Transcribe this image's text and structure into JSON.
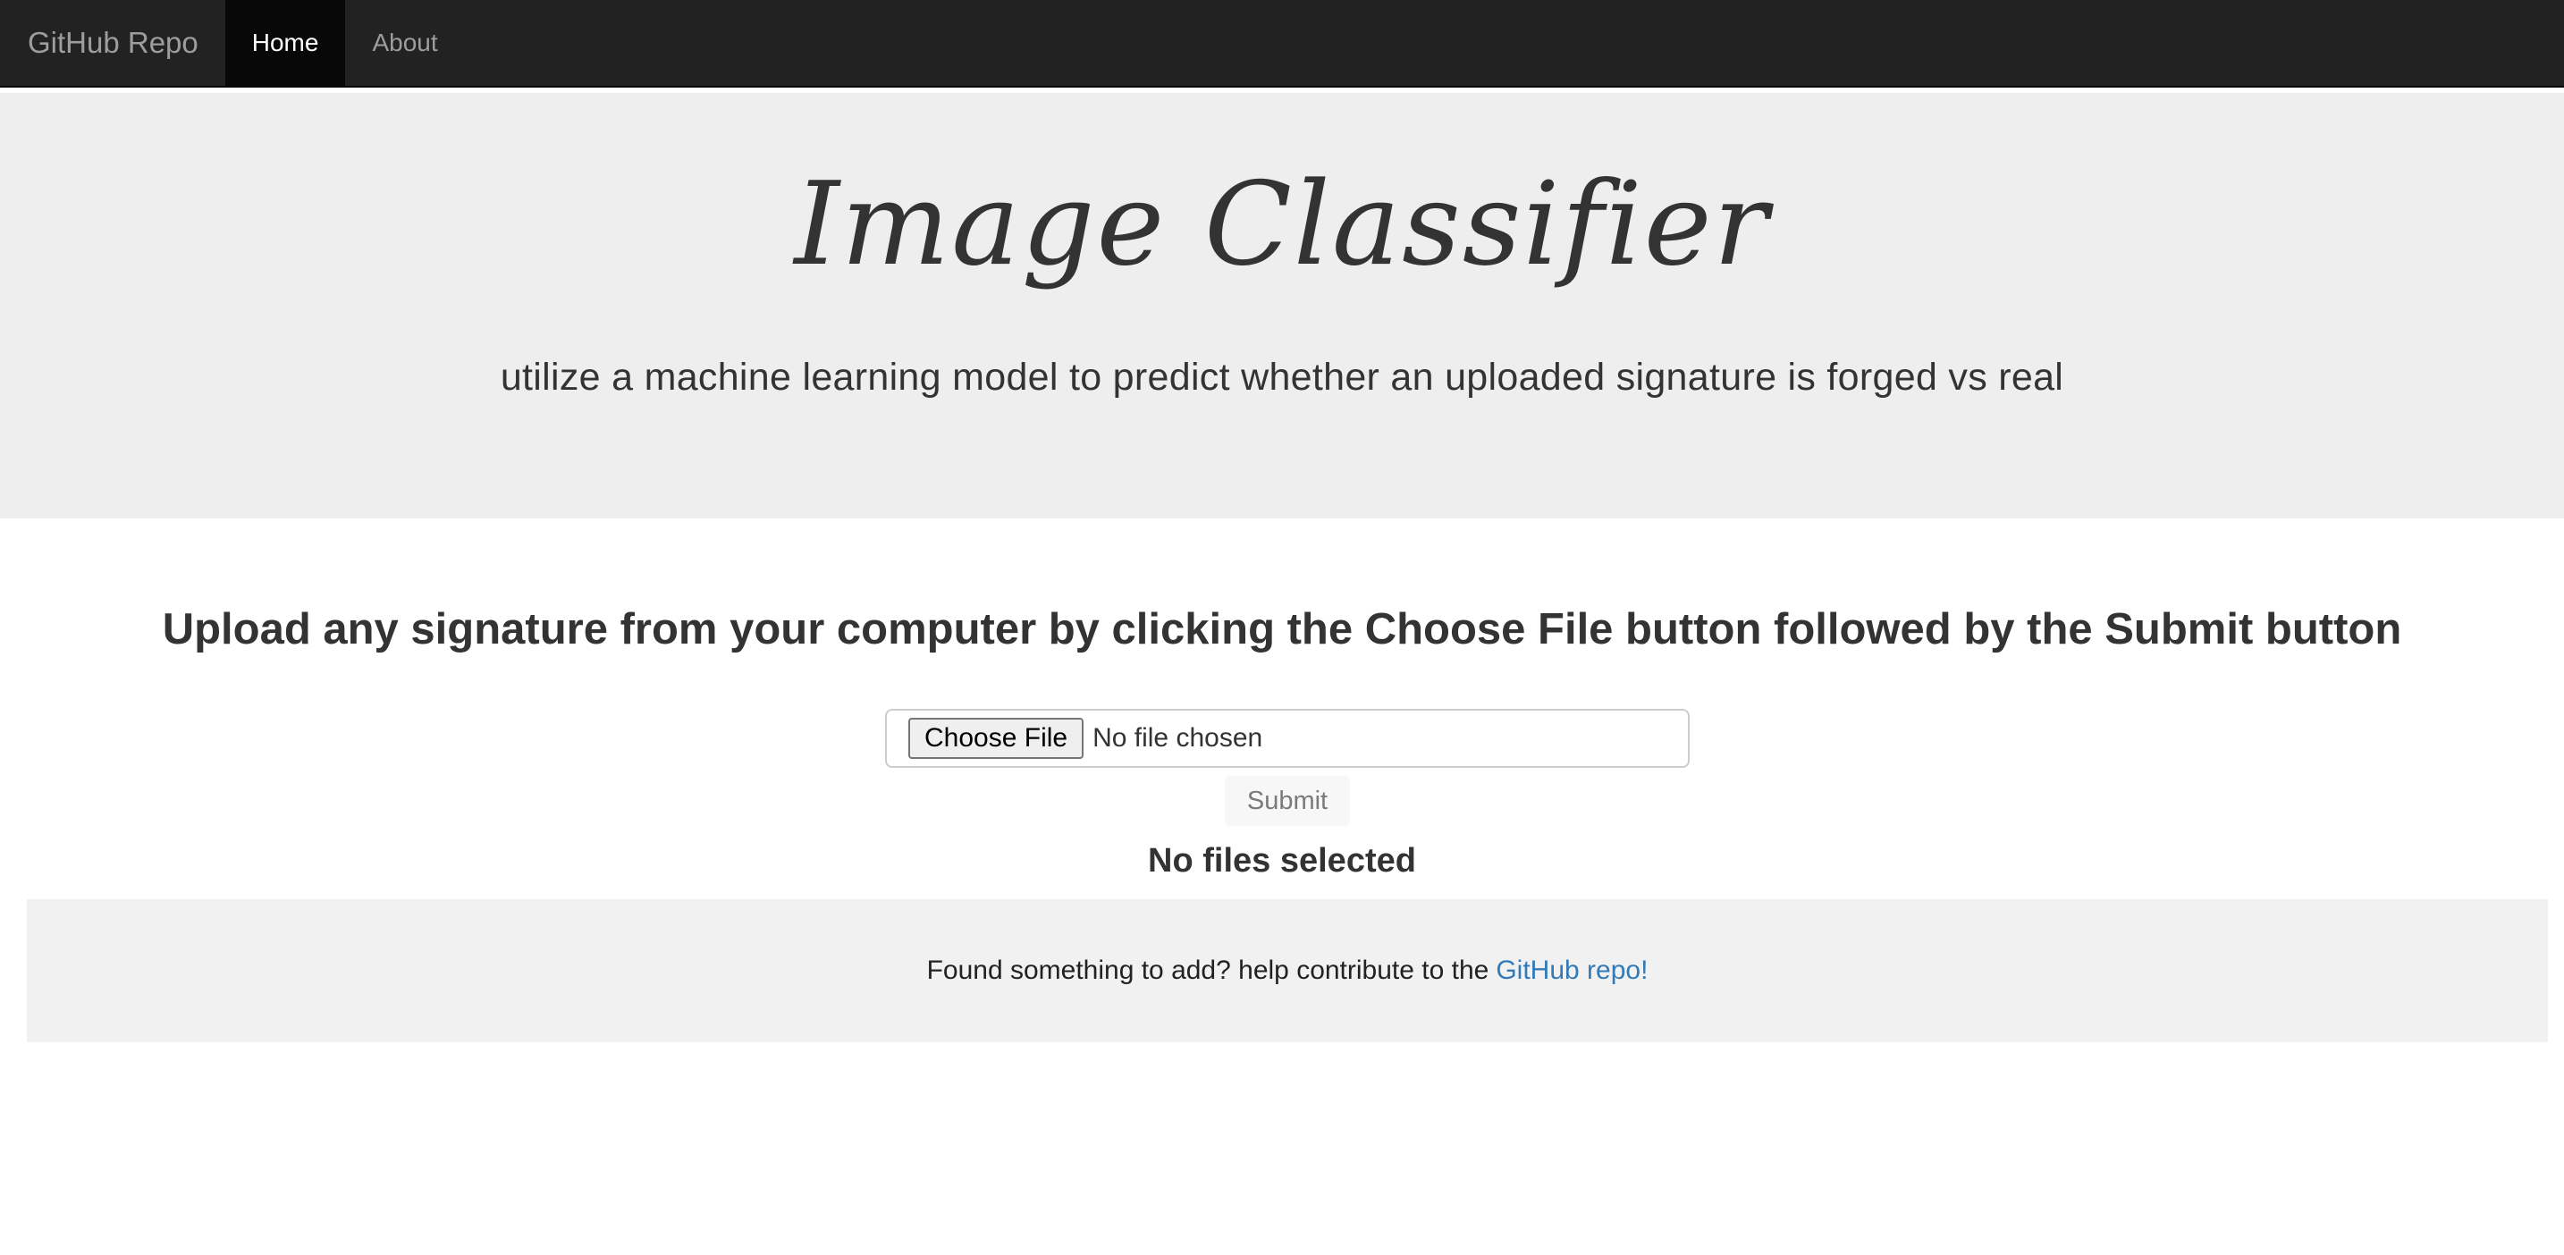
{
  "navbar": {
    "brand": "GitHub Repo",
    "items": [
      {
        "label": "Home",
        "active": true
      },
      {
        "label": "About",
        "active": false
      }
    ]
  },
  "jumbotron": {
    "title": "Image Classifier",
    "subtitle": "utilize a machine learning model to predict whether an uploaded signature is forged vs real"
  },
  "upload": {
    "heading": "Upload any signature from your computer by clicking the Choose File button followed by the Submit button",
    "choose_button": "Choose File",
    "file_status": "No file chosen",
    "submit_label": "Submit",
    "result_text": "No files selected"
  },
  "footer": {
    "text": "Found something to add? help contribute to the",
    "link_label": "GitHub repo!"
  },
  "colors": {
    "navbar_bg": "#222222",
    "jumbotron_bg": "#eeeeee",
    "link": "#337ab7"
  }
}
